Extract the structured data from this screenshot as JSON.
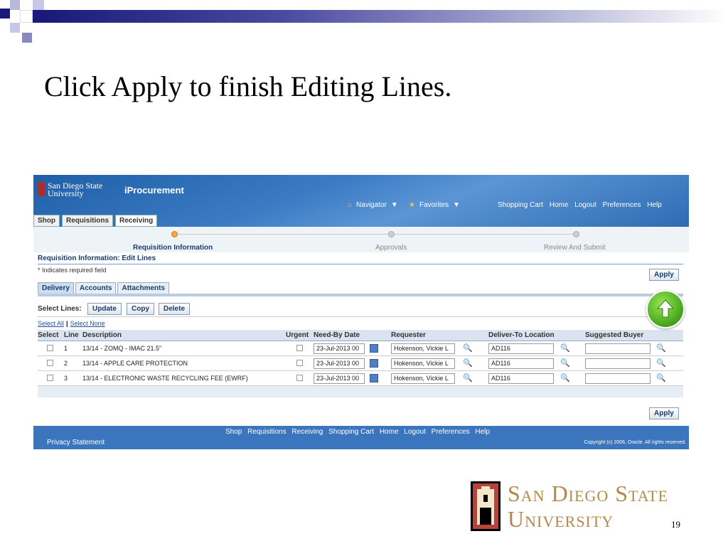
{
  "slide": {
    "title": "Click Apply to finish Editing Lines.",
    "page_number": "19",
    "bottom_logo": {
      "line1": "San Diego State",
      "line2": "University"
    }
  },
  "app": {
    "logo_line1": "San Diego State",
    "logo_line2": "University",
    "name": "iProcurement",
    "global_nav": [
      "Navigator",
      "Favorites",
      "Shopping Cart",
      "Home",
      "Logout",
      "Preferences",
      "Help"
    ],
    "tabs": [
      "Shop",
      "Requisitions",
      "Receiving"
    ],
    "train_steps": [
      "Requisition Information",
      "Approvals",
      "Review And Submit"
    ],
    "section_title": "Requisition Information: Edit Lines",
    "required_note": "* Indicates required field",
    "apply_label": "Apply",
    "subtabs": [
      "Delivery",
      "Accounts",
      "Attachments"
    ],
    "select_lines_label": "Select Lines:",
    "line_buttons": [
      "Update",
      "Copy",
      "Delete"
    ],
    "select_all": "Select All",
    "select_none": "Select None",
    "columns": [
      "Select",
      "Line",
      "Description",
      "Urgent",
      "Need-By Date",
      "Requester",
      "Deliver-To Location",
      "Suggested Buyer"
    ],
    "rows": [
      {
        "line": "1",
        "description": "13/14 - ZOMQ - IMAC 21.5\"",
        "need_by": "23-Jul-2013 00",
        "requester": "Hokenson, Vickie L",
        "location": "AD116",
        "buyer": ""
      },
      {
        "line": "2",
        "description": "13/14 - APPLE CARE PROTECTION",
        "need_by": "23-Jul-2013 00",
        "requester": "Hokenson, Vickie L",
        "location": "AD116",
        "buyer": ""
      },
      {
        "line": "3",
        "description": "13/14 - ELECTRONIC WASTE RECYCLING FEE (EWRF)",
        "need_by": "23-Jul-2013 00",
        "requester": "Hokenson, Vickie L",
        "location": "AD116",
        "buyer": ""
      }
    ],
    "footer_links": [
      "Shop",
      "Requisitions",
      "Receiving",
      "Shopping Cart",
      "Home",
      "Logout",
      "Preferences",
      "Help"
    ],
    "privacy": "Privacy Statement",
    "copyright": "Copyright (c) 2006, Oracle. All rights reserved."
  },
  "colors": {
    "header": "#3b7bc3",
    "accent": "#f6a93b",
    "footer": "#3b75bd",
    "sdsu_gold": "#b38a4b"
  },
  "icons": [
    "navigator-icon",
    "favorites-icon",
    "calendar-icon",
    "search-icon",
    "up-arrow-icon"
  ]
}
